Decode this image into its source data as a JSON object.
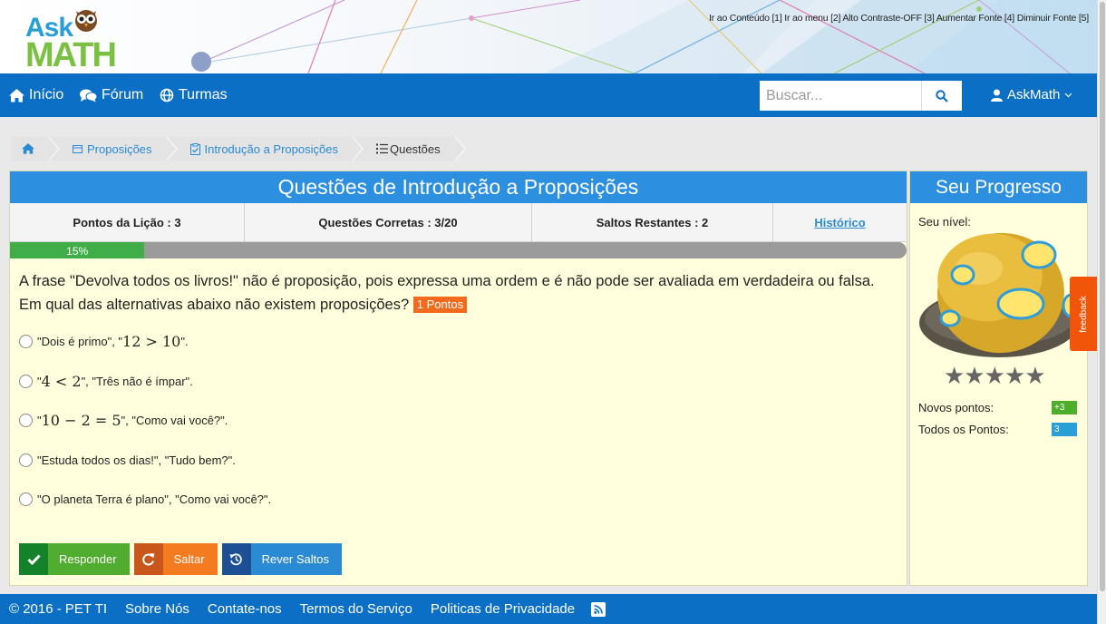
{
  "header": {
    "logo_ask": "Ask",
    "logo_math": "MATH",
    "accessibility_bar": "Ir ao Conteúdo [1] Ir ao menu [2] Alto Contraste-OFF [3] Aumentar Fonte [4] Diminuir Fonte [5]"
  },
  "nav": {
    "home_label": "Início",
    "forum_label": "Fórum",
    "classes_label": "Turmas",
    "search_placeholder": "Buscar...",
    "user_label": "AskMath",
    "icons": [
      "home-icon",
      "forum-icon",
      "classes-icon",
      "search-icon",
      "user-icon",
      "chevron-down-icon"
    ]
  },
  "breadcrumb": {
    "items": [
      {
        "label": "",
        "icon": "home-icon"
      },
      {
        "label": "Proposições",
        "icon": "window-icon"
      },
      {
        "label": "Introdução a Proposições",
        "icon": "clipboard-check-icon"
      },
      {
        "label": "Questões",
        "icon": "list-icon"
      }
    ]
  },
  "main": {
    "title": "Questões de Introdução a Proposições",
    "stats": {
      "lesson_points": "Pontos da Lição : 3",
      "correct": "Questões Corretas : 3/20",
      "skips": "Saltos Restantes : 2",
      "history": "Histórico"
    },
    "progress_percent": 15,
    "progress_label": "15%",
    "question_text": "A frase \"Devolva todos os livros!\" não é proposição, pois expressa uma ordem e é não pode ser avaliada em verdadeira ou falsa.",
    "question_prompt": "Em qual das alternativas abaixo não existem proposições?",
    "points_badge": "1 Pontos",
    "options": [
      {
        "pre": "\"Dois é primo\", \"",
        "math": "12 > 10",
        "post": "\"."
      },
      {
        "pre": "\"",
        "math": "4 < 2",
        "post": "\", \"Três não é ímpar\"."
      },
      {
        "pre": "\"",
        "math": "10 − 2 = 5",
        "post": "\", \"Como vai você?\"."
      },
      {
        "pre": "\"Estuda todos os dias!\", \"Tudo bem?\".",
        "math": "",
        "post": ""
      },
      {
        "pre": "\"O planeta Terra é plano\", \"Como vai você?\".",
        "math": "",
        "post": ""
      }
    ],
    "buttons": {
      "answer": "Responder",
      "skip": "Saltar",
      "review": "Rever Saltos"
    },
    "colors": {
      "answer_dark": "#14822a",
      "answer_light": "#51ad2f",
      "skip_dark": "#c9571b",
      "skip_light": "#f47b20",
      "review_dark": "#1d4f95",
      "review_light": "#2a8ad4"
    }
  },
  "side": {
    "title": "Seu Progresso",
    "level_label": "Seu nível:",
    "stars": "★★★★★",
    "new_points_label": "Novos pontos:",
    "new_points_value": "+3",
    "total_points_label": "Todos os Pontos:",
    "total_points_value": "3",
    "feedback": "feedback"
  },
  "footer": {
    "copyright": "© 2016 - PET TI",
    "about": "Sobre Nós",
    "contact": "Contate-nos",
    "terms": "Termos do Serviço",
    "privacy": "Politicas de Privacidade"
  },
  "theme": {
    "primary": "#0b6fc6",
    "panel_header": "#2d8fe0",
    "panel_bg": "#ffffdd",
    "progress_green": "#3fae49",
    "badge_orange": "#f26b1d"
  }
}
